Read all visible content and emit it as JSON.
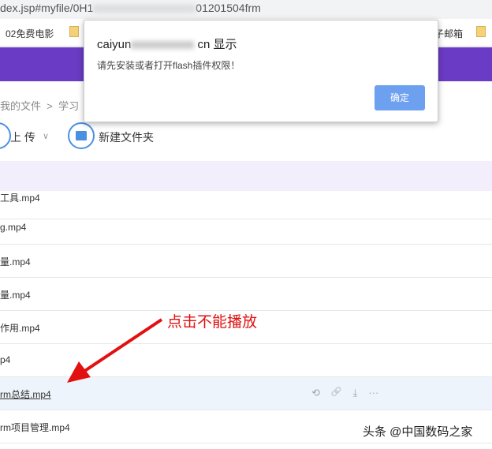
{
  "browser": {
    "url_prefix": "dex.jsp#myfile/0H1",
    "url_suffix": "01201504frm"
  },
  "bookmarks": [
    {
      "label": "02免费电影"
    },
    {
      "label": "子邮箱"
    }
  ],
  "breadcrumb": {
    "root": "我的文件",
    "sep": ">",
    "current": "学习"
  },
  "toolbar": {
    "upload": "上 传",
    "upload_caret": "∨",
    "new_folder": "新建文件夹"
  },
  "files": [
    {
      "name": "工具.mp4"
    },
    {
      "name": "g.mp4"
    },
    {
      "name": "量.mp4"
    },
    {
      "name": "量.mp4"
    },
    {
      "name": "作用.mp4"
    },
    {
      "name": "p4"
    },
    {
      "name": "rm总结.mp4"
    },
    {
      "name": "rm项目管理.mp4"
    }
  ],
  "row_actions": {
    "share": "⟲",
    "link": "🔗",
    "download": "⤓",
    "more": "···"
  },
  "dialog": {
    "title_prefix": "caiyun",
    "title_suffix": "cn 显示",
    "message": "请先安装或者打开flash插件权限！",
    "ok": "确定"
  },
  "annotation": "点击不能播放",
  "watermark": "头条 @中国数码之家"
}
